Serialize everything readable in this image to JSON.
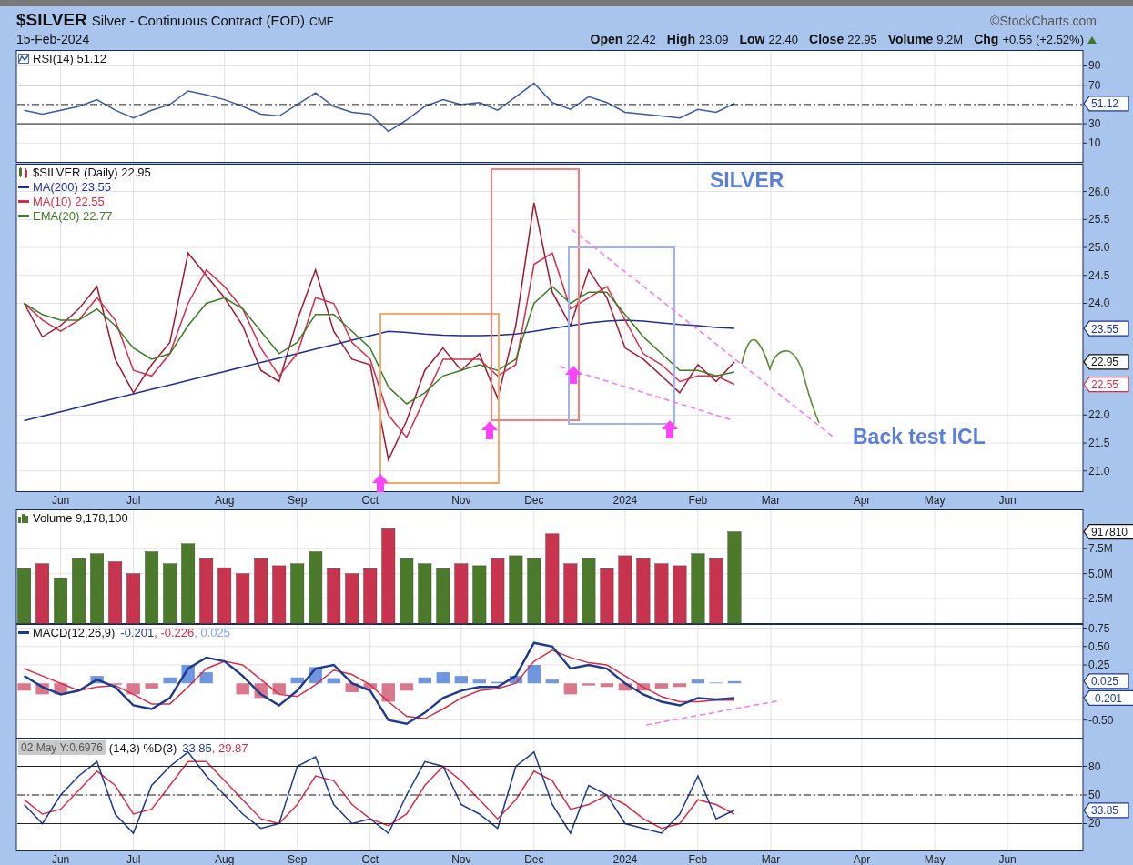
{
  "header": {
    "symbol": "$SILVER",
    "name": "Silver - Continuous Contract (EOD)",
    "exchange": "CME",
    "copyright": "©StockCharts.com",
    "date": "15-Feb-2024",
    "quote": [
      {
        "label": "Open",
        "value": "22.42"
      },
      {
        "label": "High",
        "value": "23.09"
      },
      {
        "label": "Low",
        "value": "22.40"
      },
      {
        "label": "Close",
        "value": "22.95"
      },
      {
        "label": "Volume",
        "value": "9.2M"
      },
      {
        "label": "Chg",
        "value": "+0.56 (+2.52%)"
      }
    ],
    "change_up": true
  },
  "rsi_panel": {
    "legend": [
      {
        "label": "RSI(14) 51.12",
        "color": "#111111"
      }
    ],
    "value_tags": [
      {
        "text": "51.12",
        "color": "#1f3a8a"
      }
    ],
    "chart_data": {
      "type": "line",
      "grid": true,
      "ylim": [
        -10,
        106
      ],
      "yticks": [
        90,
        70,
        30,
        10
      ],
      "categories": [
        null,
        null,
        null,
        null,
        null,
        null,
        null,
        null,
        null,
        null,
        null,
        null,
        null,
        null,
        null,
        null,
        null,
        null,
        null,
        null,
        null,
        null,
        null,
        null,
        null,
        null,
        null,
        null,
        null,
        null,
        null,
        null,
        null,
        null,
        null,
        null,
        null,
        null,
        null,
        null,
        null,
        null,
        null,
        null,
        null,
        null,
        null,
        null,
        null,
        null,
        null,
        null,
        null,
        null,
        null,
        null,
        null,
        null,
        null
      ],
      "series": [
        {
          "color": "#3b5b9e",
          "values": [
            44,
            40,
            44,
            48,
            55,
            44,
            36,
            44,
            50,
            64,
            60,
            55,
            48,
            40,
            38,
            50,
            62,
            48,
            42,
            40,
            22,
            34,
            48,
            55,
            50,
            52,
            44,
            58,
            72,
            52,
            45,
            58,
            52,
            42,
            40,
            38,
            36,
            45,
            42,
            51,
            null,
            null,
            null,
            null,
            null,
            null,
            null,
            null,
            null,
            null,
            null,
            null,
            null,
            null,
            null,
            null,
            null,
            null,
            null
          ]
        }
      ]
    }
  },
  "price_panel": {
    "legend": [
      {
        "label": "$SILVER (Daily) 22.95",
        "color": "#111111"
      },
      {
        "label": "MA(200) 23.55",
        "color": "#1f2f8f"
      },
      {
        "label": "MA(10) 22.55",
        "color": "#d0304a"
      },
      {
        "label": "EMA(20) 22.77",
        "color": "#3f7a2a"
      }
    ],
    "value_tags": [
      {
        "text": "23.55",
        "color": "#1f2f8f"
      },
      {
        "text": "22.95",
        "color": "#111111"
      },
      {
        "text": "22.55",
        "color": "#d0304a"
      }
    ],
    "chart_data": {
      "type": "line",
      "grid": true,
      "ylim": [
        20.63,
        26.49
      ],
      "yticks": [
        {
          "value": 21,
          "label": "21.0"
        },
        {
          "value": 21.5,
          "label": "21.5"
        },
        {
          "value": 22,
          "label": "22.0"
        },
        {
          "value": 24,
          "label": "24.0"
        },
        {
          "value": 24.5,
          "label": "24.5"
        },
        {
          "value": 25,
          "label": "25.0"
        },
        {
          "value": 25.5,
          "label": "25.5"
        },
        {
          "value": 26,
          "label": "26.0"
        }
      ],
      "categories": [
        null,
        null,
        "Jun",
        null,
        null,
        null,
        "Jul",
        null,
        null,
        null,
        null,
        "Aug",
        null,
        null,
        null,
        "Sep",
        null,
        null,
        null,
        "Oct",
        null,
        null,
        null,
        null,
        "Nov",
        null,
        null,
        null,
        "Dec",
        null,
        null,
        null,
        null,
        "2024",
        null,
        null,
        null,
        "Feb",
        null,
        null,
        null,
        "Mar",
        null,
        null,
        null,
        null,
        "Apr",
        null,
        null,
        null,
        "May",
        null,
        null,
        null,
        "Jun",
        null,
        null,
        null,
        null
      ],
      "series": [
        {
          "color": "#9b1b30",
          "values": [
            24.0,
            23.4,
            23.6,
            23.9,
            24.3,
            23.0,
            22.4,
            22.9,
            23.3,
            24.9,
            24.5,
            24.1,
            23.6,
            22.8,
            22.6,
            23.7,
            24.6,
            23.5,
            23.0,
            22.9,
            21.2,
            21.9,
            22.8,
            23.2,
            22.8,
            23.1,
            22.3,
            23.6,
            25.8,
            24.2,
            23.6,
            24.6,
            24.1,
            23.2,
            23.0,
            22.7,
            22.4,
            22.9,
            22.6,
            22.95,
            null,
            null,
            null,
            null,
            null,
            null,
            null,
            null,
            null,
            null,
            null,
            null,
            null,
            null,
            null,
            null,
            null,
            null,
            null
          ]
        },
        {
          "color": "#1f2f8f",
          "values": [
            21.9,
            21.98,
            22.06,
            22.14,
            22.22,
            22.3,
            22.38,
            22.46,
            22.54,
            22.62,
            22.7,
            22.78,
            22.86,
            22.94,
            23.02,
            23.1,
            23.18,
            23.26,
            23.34,
            23.42,
            23.5,
            23.48,
            23.45,
            23.43,
            23.42,
            23.42,
            23.43,
            23.45,
            23.5,
            23.55,
            23.6,
            23.65,
            23.68,
            23.7,
            23.68,
            23.65,
            23.62,
            23.6,
            23.57,
            23.55,
            null,
            null,
            null,
            null,
            null,
            null,
            null,
            null,
            null,
            null,
            null,
            null,
            null,
            null,
            null,
            null,
            null,
            null,
            null
          ]
        },
        {
          "color": "#d0304a",
          "values": [
            24.0,
            23.7,
            23.5,
            23.7,
            24.1,
            23.7,
            22.8,
            22.7,
            23.1,
            24.0,
            24.6,
            24.3,
            23.9,
            23.2,
            22.7,
            23.1,
            24.1,
            24.0,
            23.3,
            23.0,
            22.0,
            21.6,
            22.3,
            23.0,
            23.0,
            23.0,
            22.7,
            22.9,
            24.7,
            24.9,
            23.9,
            24.1,
            24.3,
            23.7,
            23.1,
            22.9,
            22.6,
            22.7,
            22.7,
            22.55,
            null,
            null,
            null,
            null,
            null,
            null,
            null,
            null,
            null,
            null,
            null,
            null,
            null,
            null,
            null,
            null,
            null,
            null,
            null
          ]
        },
        {
          "color": "#3f7a2a",
          "values": [
            24.0,
            23.8,
            23.7,
            23.7,
            23.9,
            23.6,
            23.2,
            23.0,
            23.1,
            23.6,
            24.0,
            24.1,
            23.9,
            23.5,
            23.1,
            23.3,
            23.8,
            23.8,
            23.5,
            23.2,
            22.5,
            22.2,
            22.4,
            22.7,
            22.8,
            22.9,
            22.8,
            23.0,
            24.0,
            24.3,
            24.0,
            24.2,
            24.2,
            23.8,
            23.4,
            23.1,
            22.8,
            22.8,
            22.7,
            22.77,
            null,
            null,
            null,
            null,
            null,
            null,
            null,
            null,
            null,
            null,
            null,
            null,
            null,
            null,
            null,
            null,
            null,
            null,
            null
          ]
        }
      ],
      "annotations": [
        "SILVER",
        "Back test ICL"
      ]
    }
  },
  "volume_panel": {
    "legend": [
      {
        "label": "Volume 9,178,100",
        "color": "#111111"
      }
    ],
    "value_tags": [
      {
        "text": "917810",
        "color": "#111111"
      }
    ],
    "chart_data": {
      "type": "bar",
      "grid": true,
      "stacked": true,
      "ylim": [
        0,
        11.4
      ],
      "yticks": [
        {
          "value": 7.5,
          "label": "7.5M"
        },
        {
          "value": 5,
          "label": "5.0M"
        },
        {
          "value": 2.5,
          "label": "2.5M"
        }
      ],
      "categories": [
        null,
        null,
        null,
        null,
        null,
        null,
        null,
        null,
        null,
        null,
        null,
        null,
        null,
        null,
        null,
        null,
        null,
        null,
        null,
        null,
        null,
        null,
        null,
        null,
        null,
        null,
        null,
        null,
        null,
        null,
        null,
        null,
        null,
        null,
        null,
        null,
        null,
        null,
        null,
        null,
        null,
        null,
        null,
        null,
        null,
        null,
        null,
        null,
        null,
        null,
        null,
        null,
        null,
        null,
        null,
        null,
        null,
        null,
        null
      ],
      "series": [
        {
          "color": "#4a7a2a",
          "values": [
            5.5,
            null,
            4.5,
            6.5,
            7.0,
            null,
            null,
            7.2,
            6.0,
            8.0,
            null,
            null,
            null,
            null,
            null,
            6.0,
            7.2,
            null,
            null,
            null,
            null,
            6.5,
            6.0,
            5.5,
            null,
            5.8,
            null,
            6.8,
            6.5,
            null,
            null,
            6.5,
            null,
            null,
            null,
            null,
            null,
            7.0,
            null,
            9.2,
            null,
            null,
            null,
            null,
            null,
            null,
            null,
            null,
            null,
            null,
            null,
            null,
            null,
            null,
            null,
            null,
            null,
            null,
            null
          ]
        },
        {
          "color": "#c8344e",
          "values": [
            null,
            6.0,
            null,
            null,
            null,
            6.2,
            5.0,
            null,
            null,
            null,
            6.5,
            5.6,
            5.0,
            6.5,
            5.8,
            null,
            null,
            5.5,
            5.0,
            5.5,
            9.5,
            null,
            null,
            null,
            6.0,
            null,
            6.5,
            null,
            null,
            9.0,
            6.0,
            null,
            5.5,
            6.8,
            6.5,
            6.0,
            5.8,
            null,
            6.5,
            null,
            null,
            null,
            null,
            null,
            null,
            null,
            null,
            null,
            null,
            null,
            null,
            null,
            null,
            null,
            null,
            null,
            null,
            null,
            null
          ]
        }
      ]
    }
  },
  "macd_panel": {
    "legend": [
      {
        "label": "MACD(12,26,9)",
        "color": "#111111",
        "values": [
          {
            "text": "-0.201",
            "color": "#1f3a8a"
          },
          {
            "text": ", -0.226",
            "color": "#d0304a"
          },
          {
            "text": ", 0.025",
            "color": "#7fa3ee"
          }
        ]
      }
    ],
    "value_tags": [
      {
        "text": "0.025",
        "color": "#1f3a8a"
      },
      {
        "text": "-0.201",
        "color": "#1f3a8a"
      }
    ],
    "chart_data": {
      "type": "line",
      "grid": true,
      "stacked": true,
      "ylim": [
        -0.745,
        0.8
      ],
      "yticks": [
        {
          "value": 0.75,
          "label": "0.75"
        },
        {
          "value": 0.5,
          "label": "0.50"
        },
        {
          "value": 0.25,
          "label": "0.25"
        },
        {
          "value": -0.5,
          "label": "-0.50"
        }
      ],
      "categories": [
        null,
        null,
        null,
        null,
        null,
        null,
        null,
        null,
        null,
        null,
        null,
        null,
        null,
        null,
        null,
        null,
        null,
        null,
        null,
        null,
        null,
        null,
        null,
        null,
        null,
        null,
        null,
        null,
        null,
        null,
        null,
        null,
        null,
        null,
        null,
        null,
        null,
        null,
        null,
        null,
        null,
        null,
        null,
        null,
        null,
        null,
        null,
        null,
        null,
        null,
        null,
        null,
        null,
        null,
        null,
        null,
        null,
        null,
        null
      ],
      "series": [
        {
          "type": "bar",
          "color": "#6f96e0",
          "values": [
            null,
            null,
            null,
            null,
            0.1,
            null,
            null,
            null,
            0.08,
            0.25,
            0.15,
            null,
            null,
            null,
            null,
            0.08,
            0.22,
            0.07,
            null,
            null,
            null,
            null,
            0.08,
            0.15,
            0.1,
            0.05,
            0.02,
            0.1,
            0.25,
            0.05,
            null,
            null,
            null,
            null,
            null,
            null,
            null,
            0.05,
            0.01,
            0.03,
            null,
            null,
            null,
            null,
            null,
            null,
            null,
            null,
            null,
            null,
            null,
            null,
            null,
            null,
            null,
            null,
            null,
            null,
            null
          ]
        },
        {
          "type": "bar",
          "color": "#d9788c",
          "values": [
            -0.1,
            -0.15,
            -0.15,
            null,
            null,
            -0.02,
            -0.15,
            -0.07,
            null,
            null,
            null,
            null,
            -0.15,
            -0.2,
            -0.15,
            null,
            null,
            null,
            -0.12,
            -0.08,
            -0.25,
            -0.1,
            null,
            null,
            null,
            null,
            null,
            null,
            null,
            null,
            -0.15,
            -0.03,
            -0.05,
            -0.1,
            -0.1,
            -0.07,
            -0.05,
            null,
            null,
            null,
            null,
            null,
            null,
            null,
            null,
            null,
            null,
            null,
            null,
            null,
            null,
            null,
            null,
            null,
            null,
            null,
            null,
            null,
            null
          ]
        },
        {
          "color": "#d0304a",
          "values": [
            0.2,
            0.1,
            0.0,
            -0.1,
            -0.05,
            -0.03,
            -0.15,
            -0.28,
            -0.28,
            -0.05,
            0.2,
            0.3,
            0.25,
            0.05,
            -0.15,
            -0.18,
            -0.02,
            0.18,
            0.12,
            -0.02,
            -0.25,
            -0.45,
            -0.48,
            -0.35,
            -0.2,
            -0.1,
            -0.07,
            0.0,
            0.3,
            0.45,
            0.35,
            0.28,
            0.25,
            0.1,
            -0.05,
            -0.18,
            -0.25,
            -0.25,
            -0.23,
            -0.23,
            null,
            null,
            null,
            null,
            null,
            null,
            null,
            null,
            null,
            null,
            null,
            null,
            null,
            null,
            null,
            null,
            null,
            null,
            null
          ]
        },
        {
          "color": "#1f3a8a",
          "values": [
            0.1,
            -0.05,
            -0.15,
            -0.1,
            0.05,
            -0.05,
            -0.3,
            -0.35,
            -0.2,
            0.2,
            0.35,
            0.3,
            0.1,
            -0.15,
            -0.3,
            -0.1,
            0.2,
            0.25,
            0.0,
            -0.1,
            -0.5,
            -0.55,
            -0.4,
            -0.2,
            -0.1,
            -0.05,
            -0.05,
            0.1,
            0.55,
            0.5,
            0.2,
            0.25,
            0.2,
            0.0,
            -0.15,
            -0.25,
            -0.3,
            -0.2,
            -0.22,
            -0.2,
            null,
            null,
            null,
            null,
            null,
            null,
            null,
            null,
            null,
            null,
            null,
            null,
            null,
            null,
            null,
            null,
            null,
            null,
            null
          ]
        }
      ]
    }
  },
  "stochastics_panel": {
    "tooltip": "02 May Y:0.6976",
    "legend": [
      {
        "label": "(14,3) %D(3)",
        "color": "#111111",
        "values": [
          {
            "text": "33.85",
            "color": "#1f3a8a"
          },
          {
            "text": ", 29.87",
            "color": "#d0304a"
          }
        ]
      }
    ],
    "value_tags": [
      {
        "text": "33.85",
        "color": "#1f3a8a"
      }
    ],
    "chart_data": {
      "type": "line",
      "grid": true,
      "ylim": [
        -8.6,
        108.6
      ],
      "yticks": [
        80,
        50,
        20
      ],
      "categories": [
        null,
        null,
        "Jun",
        null,
        null,
        null,
        "Jul",
        null,
        null,
        null,
        null,
        "Aug",
        null,
        null,
        null,
        "Sep",
        null,
        null,
        null,
        "Oct",
        null,
        null,
        null,
        null,
        "Nov",
        null,
        null,
        null,
        "Dec",
        null,
        null,
        null,
        null,
        "2024",
        null,
        null,
        null,
        "Feb",
        null,
        null,
        null,
        "Mar",
        null,
        null,
        null,
        null,
        "Apr",
        null,
        null,
        null,
        "May",
        null,
        null,
        null,
        "Jun",
        null,
        null,
        null,
        null
      ],
      "series": [
        {
          "color": "#d0304a",
          "values": [
            45,
            30,
            35,
            55,
            75,
            60,
            30,
            35,
            60,
            85,
            85,
            65,
            45,
            25,
            20,
            40,
            70,
            65,
            40,
            25,
            18,
            30,
            60,
            80,
            65,
            45,
            25,
            45,
            75,
            65,
            35,
            40,
            50,
            40,
            25,
            15,
            20,
            45,
            40,
            30,
            null,
            null,
            null,
            null,
            null,
            null,
            null,
            null,
            null,
            null,
            null,
            null,
            null,
            null,
            null,
            null,
            null,
            null,
            null
          ]
        },
        {
          "color": "#1f3a8a",
          "values": [
            40,
            20,
            50,
            70,
            85,
            30,
            10,
            60,
            80,
            95,
            70,
            50,
            30,
            15,
            20,
            80,
            90,
            40,
            20,
            25,
            10,
            50,
            85,
            80,
            40,
            30,
            15,
            80,
            95,
            40,
            10,
            60,
            50,
            20,
            15,
            10,
            30,
            70,
            25,
            34,
            null,
            null,
            null,
            null,
            null,
            null,
            null,
            null,
            null,
            null,
            null,
            null,
            null,
            null,
            null,
            null,
            null,
            null,
            null
          ]
        }
      ]
    }
  }
}
